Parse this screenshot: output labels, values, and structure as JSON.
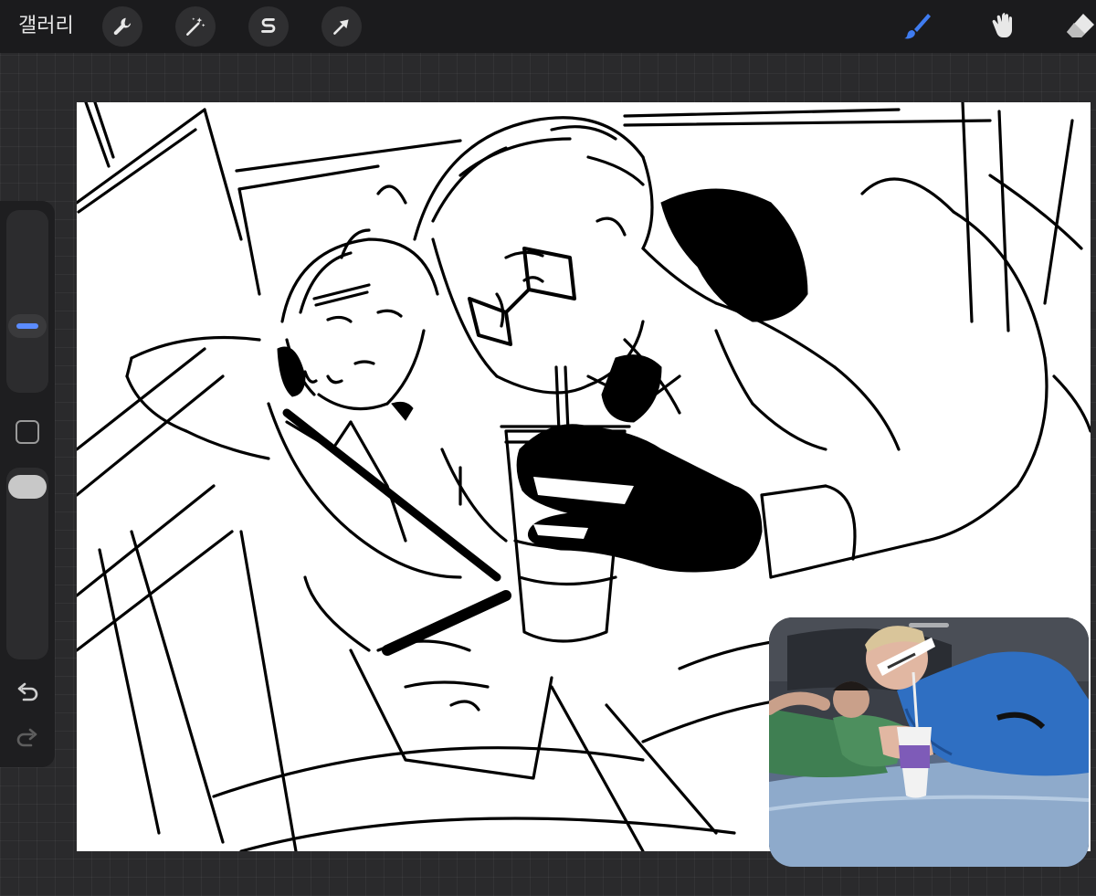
{
  "toolbar": {
    "gallery_label": "갤러리",
    "left_tools": [
      "wrench-icon",
      "magic-wand-icon",
      "selection-s-icon",
      "arrow-icon"
    ],
    "right_tools": [
      "brush-icon",
      "smudge-icon",
      "eraser-icon"
    ],
    "active_tool_color": "#3f7cf0"
  },
  "sidebar": {
    "brush_size_level": 0.6,
    "opacity_level": 0.1,
    "undo_icon": "undo-icon",
    "redo_icon": "redo-icon"
  },
  "colors": {
    "toolbar_bg": "#1b1b1d",
    "workspace_bg": "#2a2a2c",
    "canvas_bg": "#ffffff",
    "accent": "#5b8cff"
  }
}
